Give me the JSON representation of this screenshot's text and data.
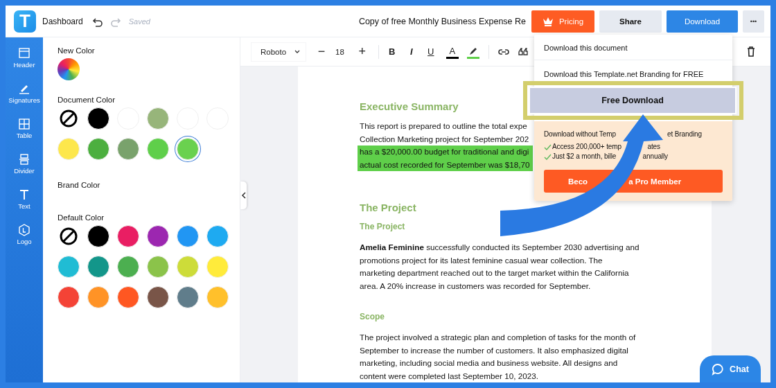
{
  "topbar": {
    "logo": "T",
    "dashboard": "Dashboard",
    "saved": "Saved",
    "title": "Copy of free Monthly Business Expense Re",
    "buttons": [
      {
        "kind": "pricing",
        "label": "Pricing"
      },
      {
        "kind": "share",
        "label": "Share"
      },
      {
        "kind": "download",
        "label": "Download"
      },
      {
        "kind": "more",
        "label": "•••"
      }
    ]
  },
  "sidebar": {
    "items": [
      {
        "kind": "header",
        "label": "Header"
      },
      {
        "kind": "signatures",
        "label": "Signatures"
      },
      {
        "kind": "table",
        "label": "Table"
      },
      {
        "kind": "divider",
        "label": "Divider"
      },
      {
        "kind": "text",
        "label": "Text"
      },
      {
        "kind": "logo",
        "label": "Logo"
      }
    ]
  },
  "color_panel": {
    "sections": [
      {
        "kind": "picker",
        "title": "New Color"
      },
      {
        "kind": "swatches",
        "title": "Document Color",
        "swatches": [
          {
            "kind": "none",
            "selected": false
          },
          {
            "kind": "color",
            "color": "#000000",
            "selected": false
          },
          {
            "kind": "color",
            "color": "#ffffff",
            "selected": false
          },
          {
            "kind": "color",
            "color": "#97b57a",
            "selected": false
          },
          {
            "kind": "color",
            "color": "#ffffff",
            "selected": false
          },
          {
            "kind": "color",
            "color": "#ffffff",
            "selected": false
          },
          {
            "kind": "color",
            "color": "#fde74c",
            "selected": false
          },
          {
            "kind": "color",
            "color": "#4caf3f",
            "selected": false
          },
          {
            "kind": "color",
            "color": "#79a26c",
            "selected": false
          },
          {
            "kind": "color",
            "color": "#5fcf4a",
            "selected": false
          },
          {
            "kind": "color",
            "color": "#6ad14f",
            "selected": true
          }
        ]
      },
      {
        "kind": "label",
        "title": "Brand Color"
      },
      {
        "kind": "swatches",
        "title": "Default Color",
        "swatches": [
          {
            "kind": "none",
            "selected": false
          },
          {
            "kind": "color",
            "color": "#000000",
            "selected": false
          },
          {
            "kind": "color",
            "color": "#e91e63",
            "selected": false
          },
          {
            "kind": "color",
            "color": "#9c27b0",
            "selected": false
          },
          {
            "kind": "color",
            "color": "#2196f3",
            "selected": false
          },
          {
            "kind": "color",
            "color": "#1eaaf1",
            "selected": false
          },
          {
            "kind": "color",
            "color": "#20bcd4",
            "selected": false
          },
          {
            "kind": "color",
            "color": "#13968a",
            "selected": false
          },
          {
            "kind": "color",
            "color": "#4caf50",
            "selected": false
          },
          {
            "kind": "color",
            "color": "#8bc34a",
            "selected": false
          },
          {
            "kind": "color",
            "color": "#cddc39",
            "selected": false
          },
          {
            "kind": "color",
            "color": "#ffeb3b",
            "selected": false
          },
          {
            "kind": "color",
            "color": "#f44336",
            "selected": false
          },
          {
            "kind": "color",
            "color": "#ff9326",
            "selected": false
          },
          {
            "kind": "color",
            "color": "#ff5722",
            "selected": false
          },
          {
            "kind": "color",
            "color": "#795548",
            "selected": false
          },
          {
            "kind": "color",
            "color": "#607d8b",
            "selected": false
          },
          {
            "kind": "color",
            "color": "#ffc02b",
            "selected": false
          }
        ]
      }
    ]
  },
  "toolbar": {
    "font": "Roboto",
    "size": "18",
    "minus": "−",
    "plus": "+",
    "tools": [
      {
        "kind": "bold",
        "label": "B"
      },
      {
        "kind": "italic",
        "label": "I"
      },
      {
        "kind": "underline",
        "label": "U"
      },
      {
        "kind": "text-color",
        "label": "A",
        "color": "#000000"
      },
      {
        "kind": "highlight",
        "color": "#5fcf4a"
      },
      {
        "kind": "link"
      },
      {
        "kind": "quote"
      },
      {
        "kind": "delete"
      }
    ]
  },
  "document": {
    "blocks": [
      {
        "kind": "heading",
        "text": "Executive Summary"
      },
      {
        "kind": "lines",
        "lines": [
          {
            "text": "This report is prepared to outline the total expe",
            "highlighted": false
          },
          {
            "text": "Collection Marketing project for September 202",
            "highlighted": false
          },
          {
            "text": "has a $20,000.00 budget for traditional and digi",
            "highlighted": true
          },
          {
            "text": "actual cost recorded for September was $18,70",
            "highlighted": true
          }
        ]
      },
      {
        "kind": "heading",
        "text": "The Project"
      },
      {
        "kind": "subheading",
        "text": "The Project"
      },
      {
        "kind": "paragraph",
        "lines": [
          "**Amelia Feminine** successfully conducted its September 2030 advertising and",
          "promotions project for its latest feminine casual wear collection. The",
          "marketing department reached out to the target market within the California",
          "area. A 20% increase in customers was recorded for September."
        ]
      },
      {
        "kind": "subheading",
        "text": "Scope"
      },
      {
        "kind": "paragraph",
        "lines": [
          "The project involved a strategic plan and completion of tasks for the month of",
          "September to increase the number of customers. It also emphasized digital",
          "marketing, including social media and business website. All designs and",
          "content were completed last September 10, 2023."
        ]
      }
    ]
  },
  "download_menu": {
    "items": [
      "Download this document",
      "Download this Template.net Branding for FREE"
    ],
    "free_button": "Free Download",
    "pro": {
      "title_before": "Download without Temp",
      "title_after": "et Branding",
      "features": [
        {
          "before": "Access 200,000+ temp",
          "after": "ates"
        },
        {
          "before": "Just $2 a month, bille",
          "after": "annually"
        }
      ],
      "button_before": "Beco",
      "button_after": "a Pro Member"
    }
  },
  "chat": {
    "label": "Chat"
  }
}
